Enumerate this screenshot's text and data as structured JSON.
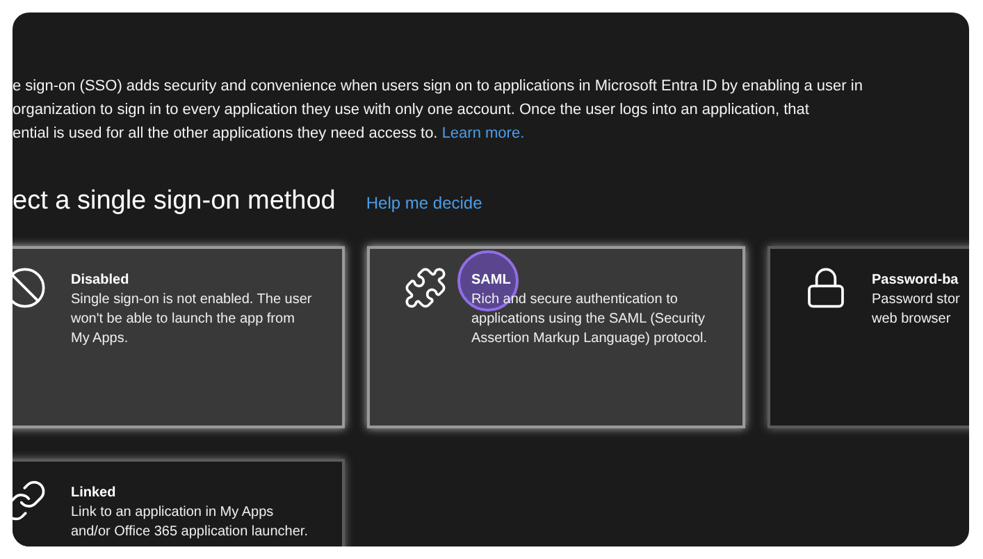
{
  "intro": {
    "lines": [
      "e sign-on (SSO) adds security and convenience when users sign on to applications in Microsoft Entra ID by enabling a user in",
      "organization to sign in to every application they use with only one account. Once the user logs into an application, that",
      "ential is used for all the other applications they need access to."
    ],
    "link": "Learn more."
  },
  "heading": {
    "title": "ect a single sign-on method",
    "link": "Help me decide"
  },
  "methods": [
    {
      "kind": "disabled",
      "title": "Disabled",
      "lines": [
        "Single sign-on is not enabled. The user",
        "won't be able to launch the app from",
        "My Apps."
      ],
      "highlighted": true,
      "clicked": false
    },
    {
      "kind": "saml",
      "title": "SAML",
      "lines": [
        "Rich and secure authentication to",
        "applications using the SAML (Security",
        "Assertion Markup Language) protocol."
      ],
      "highlighted": true,
      "clicked": true
    },
    {
      "kind": "password",
      "title": "Password-ba",
      "lines": [
        "Password stor",
        "web browser"
      ],
      "highlighted": false,
      "clicked": false
    },
    {
      "kind": "linked",
      "title": "Linked",
      "lines": [
        "Link to an application in My Apps",
        "and/or Office 365 application launcher."
      ],
      "highlighted": false,
      "clicked": false
    }
  ]
}
